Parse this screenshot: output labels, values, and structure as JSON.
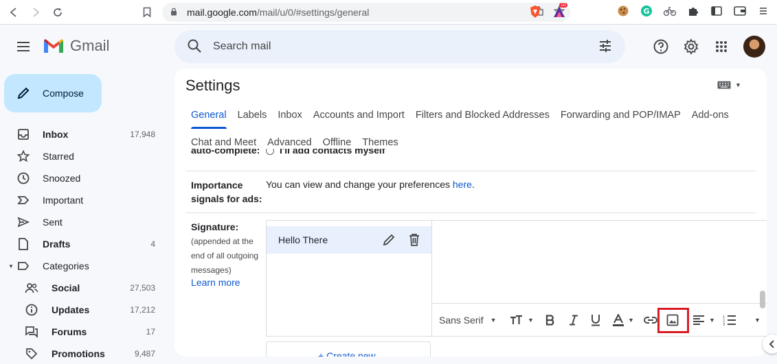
{
  "browser": {
    "url_host": "mail.google.com",
    "url_path": "/mail/u/0/#settings/general",
    "brave_badge": "10"
  },
  "header": {
    "app_name": "Gmail",
    "search_placeholder": "Search mail"
  },
  "sidebar": {
    "compose_label": "Compose",
    "items": [
      {
        "label": "Inbox",
        "count": "17,948",
        "bold": true
      },
      {
        "label": "Starred",
        "count": ""
      },
      {
        "label": "Snoozed",
        "count": ""
      },
      {
        "label": "Important",
        "count": ""
      },
      {
        "label": "Sent",
        "count": ""
      },
      {
        "label": "Drafts",
        "count": "4",
        "bold": true
      },
      {
        "label": "Categories",
        "count": ""
      }
    ],
    "categories": [
      {
        "label": "Social",
        "count": "27,503"
      },
      {
        "label": "Updates",
        "count": "17,212"
      },
      {
        "label": "Forums",
        "count": "17"
      },
      {
        "label": "Promotions",
        "count": "9,487"
      }
    ]
  },
  "settings": {
    "title": "Settings",
    "tabs_row1": [
      "General",
      "Labels",
      "Inbox",
      "Accounts and Import",
      "Filters and Blocked Addresses",
      "Forwarding and POP/IMAP",
      "Add-ons"
    ],
    "tabs_row2": [
      "Chat and Meet",
      "Advanced",
      "Offline",
      "Themes"
    ],
    "active_tab": "General",
    "cut_row_label": "auto-complete:",
    "cut_row_option": "I'll add contacts myself",
    "importance": {
      "label_line1": "Importance",
      "label_line2": "signals for ads:",
      "text": "You can view and change your preferences ",
      "link": "here",
      "suffix": "."
    },
    "signature": {
      "label": "Signature:",
      "sub_line1": "(appended at the",
      "sub_line2": "end of all outgoing",
      "sub_line3": "messages)",
      "learn_more": "Learn more",
      "item_name": "Hello There",
      "font_name": "Sans Serif",
      "create_new": "+ Create new"
    }
  }
}
